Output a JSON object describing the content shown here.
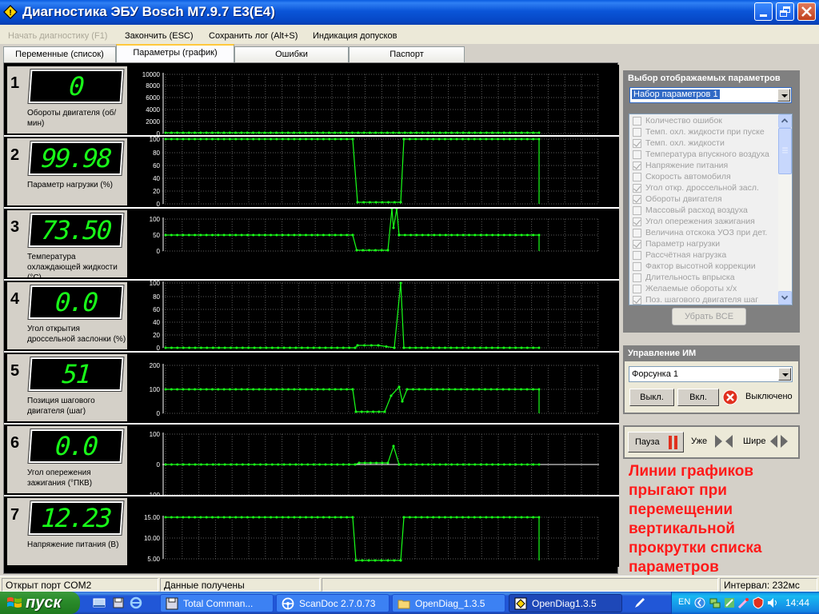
{
  "window": {
    "title": "Диагностика ЭБУ Bosch M7.9.7 E3(E4)"
  },
  "menu": [
    "Начать диагностику (F1)",
    "Закончить (ESC)",
    "Сохранить лог (Alt+S)",
    "Индикация допусков"
  ],
  "tabs": [
    "Переменные (список)",
    "Параметры (график)",
    "Ошибки",
    "Паспорт"
  ],
  "rows": [
    {
      "num": "1",
      "value": "0",
      "label": "Обороты двигателя (об/мин)",
      "ticks": [
        "10000",
        "8000",
        "6000",
        "4000",
        "2000",
        "0"
      ]
    },
    {
      "num": "2",
      "value": "99.98",
      "label": "Параметр нагрузки (%)",
      "ticks": [
        "100",
        "80",
        "60",
        "40",
        "20",
        "0"
      ]
    },
    {
      "num": "3",
      "value": "73.50",
      "label": "Температура охлаждающей жидкости (°C)",
      "ticks": [
        "100",
        "50",
        "0"
      ]
    },
    {
      "num": "4",
      "value": "0.0",
      "label": "Угол открытия дроссельной заслонки (%)",
      "ticks": [
        "100",
        "80",
        "60",
        "40",
        "20",
        "0"
      ]
    },
    {
      "num": "5",
      "value": "51",
      "label": "Позиция шагового двигателя (шаг)",
      "ticks": [
        "200",
        "100",
        "0"
      ]
    },
    {
      "num": "6",
      "value": "0.0",
      "label": "Угол опережения зажигания (°ПКВ)",
      "ticks": [
        "100",
        "0",
        "-100"
      ]
    },
    {
      "num": "7",
      "value": "12.23",
      "label": "Напряжение питания (В)",
      "ticks": [
        "15.00",
        "10.00",
        "5.00"
      ]
    }
  ],
  "params_panel": {
    "title": "Выбор отображаемых параметров",
    "set": "Набор параметров 1",
    "items": [
      {
        "label": "Количество ошибок",
        "checked": false
      },
      {
        "label": "Темп. охл. жидкости при пуске",
        "checked": false
      },
      {
        "label": "Темп. охл. жидкости",
        "checked": true
      },
      {
        "label": "Температура впускного воздуха",
        "checked": false
      },
      {
        "label": "Напряжение питания",
        "checked": true
      },
      {
        "label": "Скорость автомобиля",
        "checked": false
      },
      {
        "label": "Угол откр. дроссельной засл.",
        "checked": true
      },
      {
        "label": "Обороты двигателя",
        "checked": true
      },
      {
        "label": "Массовый расход воздуха",
        "checked": false
      },
      {
        "label": "Угол опережения зажигания",
        "checked": true
      },
      {
        "label": "Величина отскока УОЗ при дет.",
        "checked": false
      },
      {
        "label": "Параметр нагрузки",
        "checked": true
      },
      {
        "label": "Рассчётная нагрузка",
        "checked": false
      },
      {
        "label": "Фактор высотной коррекции",
        "checked": false
      },
      {
        "label": "Длительность впрыска",
        "checked": false
      },
      {
        "label": "Желаемые обороты х/х",
        "checked": false
      },
      {
        "label": "Поз. шагового двигателя шаг",
        "checked": true
      }
    ],
    "remove_all": "Убрать ВСЕ"
  },
  "im_panel": {
    "title": "Управление ИМ",
    "device": "Форсунка 1",
    "off_label": "Выкл.",
    "on_label": "Вкл.",
    "state": "Выключено"
  },
  "controls": {
    "pause": "Пауза",
    "narrower": "Уже",
    "wider": "Шире"
  },
  "note": "Линии графиков прыгают при перемещении вертикальной прокрутки списка параметров",
  "status": {
    "port": "Открыт порт COM2",
    "data": "Данные получены",
    "interval": "Интервал: 232мс"
  },
  "taskbar": {
    "start": "пуск",
    "tasks": [
      "Total Comman...",
      "ScanDoc 2.7.0.73",
      "OpenDiag_1.3.5",
      "OpenDiag1.3.5"
    ],
    "lang": "EN",
    "clock": "14:44"
  },
  "colors": {
    "trace": "#19ff19",
    "grid": "#3a3a3a",
    "accent_red": "#ff1a1a"
  }
}
